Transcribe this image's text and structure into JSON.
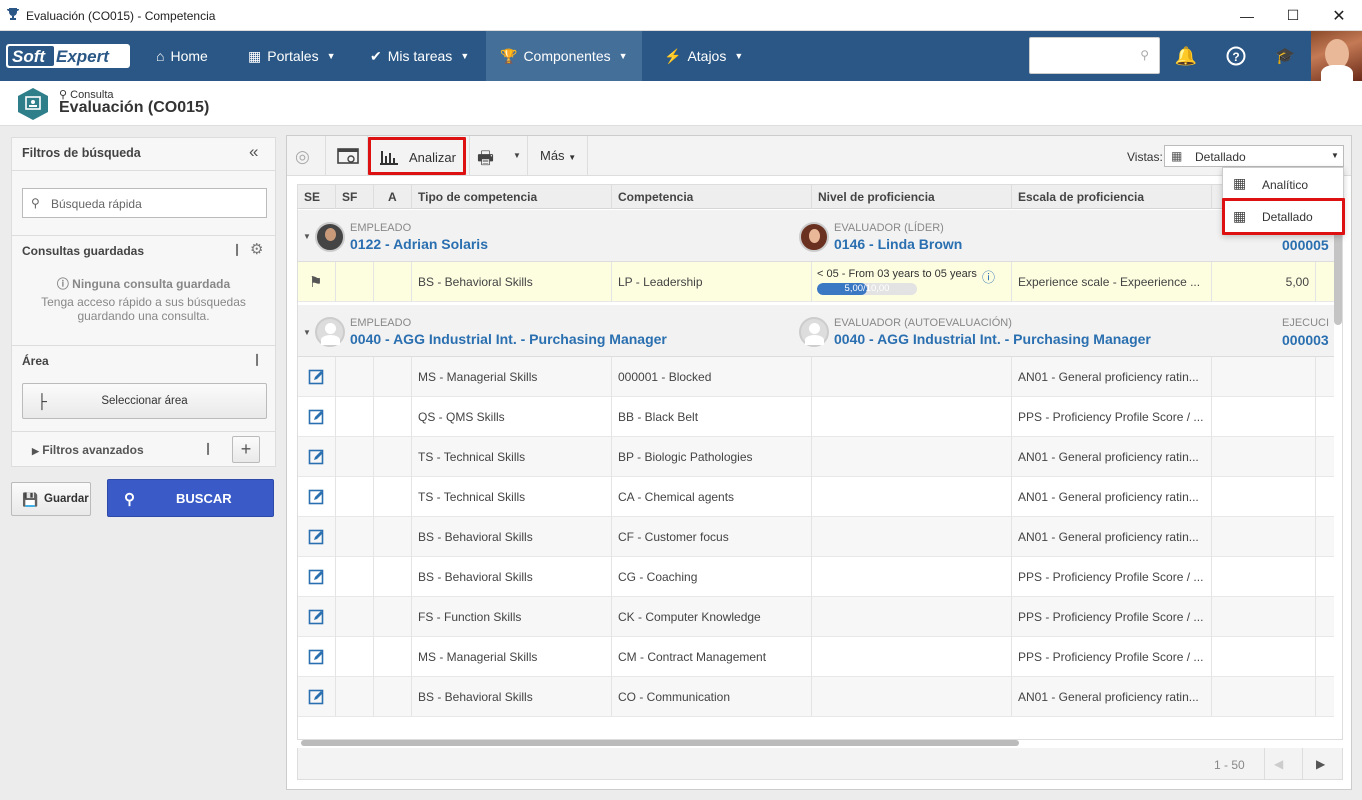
{
  "window": {
    "title": "Evaluación (CO015) - Competencia"
  },
  "nav": {
    "logo": "SoftExpert",
    "items": [
      {
        "label": "Home",
        "icon": "home-icon"
      },
      {
        "label": "Portales",
        "icon": "grid-icon"
      },
      {
        "label": "Mis tareas",
        "icon": "check-icon"
      },
      {
        "label": "Componentes",
        "icon": "trophy-icon"
      },
      {
        "label": "Atajos",
        "icon": "bolt-icon"
      }
    ]
  },
  "breadcrumb": {
    "sub": "Consulta",
    "title": "Evaluación (CO015)"
  },
  "sidebar": {
    "title": "Filtros de búsqueda",
    "quick_search_placeholder": "Búsqueda rápida",
    "saved_title": "Consultas guardadas",
    "saved_empty": "Ninguna consulta guardada",
    "saved_hint": "Tenga acceso rápido a sus búsquedas guardando una consulta.",
    "area_title": "Área",
    "area_button": "Seleccionar área",
    "advanced": "Filtros avanzados",
    "save_label": "Guardar",
    "search_label": "BUSCAR"
  },
  "toolbar": {
    "analyze": "Analizar",
    "more": "Más",
    "views_label": "Vistas:",
    "views_value": "Detallado",
    "views_options": [
      "Analítico",
      "Detallado"
    ]
  },
  "grid": {
    "columns": [
      "SE",
      "SF",
      "A",
      "Tipo de competencia",
      "Competencia",
      "Nivel de proficiencia",
      "Escala de proficiencia"
    ],
    "group1": {
      "emp_label": "EMPLEADO",
      "emp_value": "0122 - Adrian Solaris",
      "eval_label": "EVALUADOR (LÍDER)",
      "eval_value": "0146 - Linda Brown",
      "code": "000005"
    },
    "row1": {
      "type": "BS - Behavioral Skills",
      "comp": "LP - Leadership",
      "level": "< 05 - From 03 years to 05 years",
      "progress_text": "5,00/10,00",
      "progress": 0.5,
      "scale": "Experience scale - Expeerience ...",
      "score": "5,00"
    },
    "group2": {
      "emp_label": "EMPLEADO",
      "emp_value": "0040 - AGG Industrial Int. - Purchasing Manager",
      "eval_label": "EVALUADOR (AUTOEVALUACIÓN)",
      "eval_value": "0040 - AGG Industrial Int. - Purchasing Manager",
      "exec_label": "EJECUCI",
      "code": "000003"
    },
    "rows": [
      {
        "type": "MS - Managerial Skills",
        "comp": "000001 - Blocked",
        "scale": "AN01 - General proficiency ratin..."
      },
      {
        "type": "QS - QMS Skills",
        "comp": "BB - Black Belt",
        "scale": "PPS - Proficiency Profile Score / ..."
      },
      {
        "type": "TS - Technical Skills",
        "comp": "BP - Biologic Pathologies",
        "scale": "AN01 - General proficiency ratin..."
      },
      {
        "type": "TS - Technical Skills",
        "comp": "CA - Chemical agents",
        "scale": "AN01 - General proficiency ratin..."
      },
      {
        "type": "BS - Behavioral Skills",
        "comp": "CF - Customer focus",
        "scale": "AN01 - General proficiency ratin..."
      },
      {
        "type": "BS - Behavioral Skills",
        "comp": "CG - Coaching",
        "scale": "PPS - Proficiency Profile Score / ..."
      },
      {
        "type": "FS - Function Skills",
        "comp": "CK - Computer Knowledge",
        "scale": "PPS - Proficiency Profile Score / ..."
      },
      {
        "type": "MS - Managerial Skills",
        "comp": "CM - Contract Management",
        "scale": "PPS - Proficiency Profile Score / ..."
      },
      {
        "type": "BS - Behavioral Skills",
        "comp": "CO - Communication",
        "scale": "AN01 - General proficiency ratin..."
      }
    ],
    "pager": "1 - 50"
  }
}
